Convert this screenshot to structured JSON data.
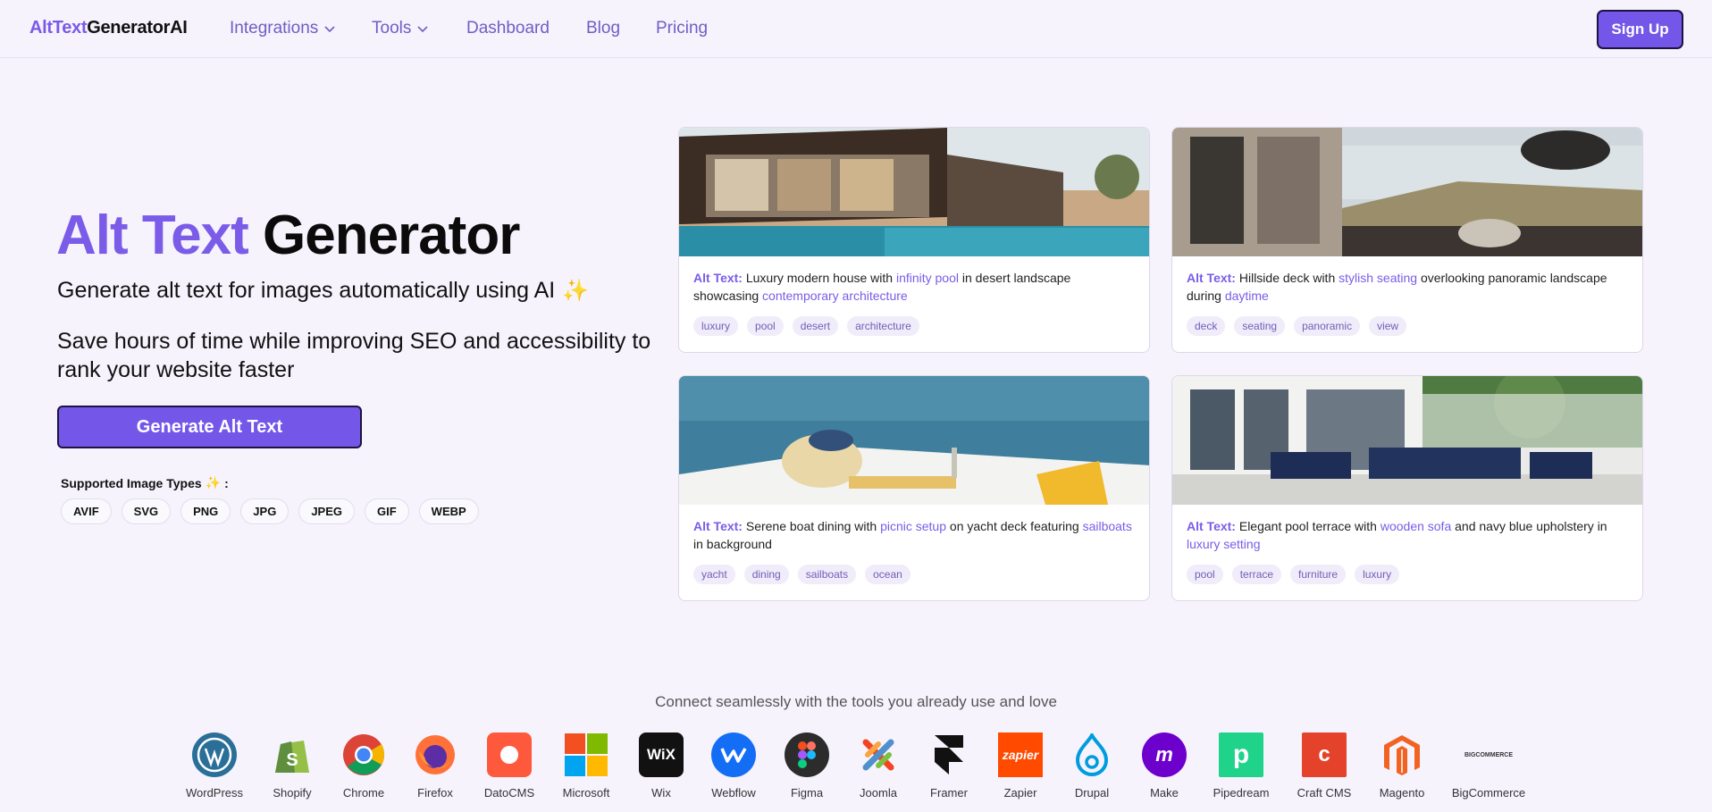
{
  "nav": {
    "brand_a": "AltText",
    "brand_b": "GeneratorAI",
    "links": [
      "Integrations",
      "Tools",
      "Dashboard",
      "Blog",
      "Pricing"
    ],
    "signup": "Sign Up"
  },
  "hero": {
    "title_a": "Alt Text",
    "title_b": "Generator",
    "sub1": "Generate alt text for images automatically using AI",
    "sub2": "Save hours of time while improving SEO and accessibility to rank your website faster",
    "cta": "Generate Alt Text",
    "types_label": "Supported Image Types",
    "types": [
      "AVIF",
      "SVG",
      "PNG",
      "JPG",
      "JPEG",
      "GIF",
      "WEBP"
    ]
  },
  "cards": [
    {
      "label": "Alt Text:",
      "t1": "Luxury modern house with",
      "h1": "infinity pool",
      "t2": "in desert landscape showcasing",
      "h2": "contemporary architecture",
      "t3": "",
      "tags": [
        "luxury",
        "pool",
        "desert",
        "architecture"
      ]
    },
    {
      "label": "Alt Text:",
      "t1": "Hillside deck with",
      "h1": "stylish seating",
      "t2": "overlooking panoramic landscape during",
      "h2": "daytime",
      "t3": "",
      "tags": [
        "deck",
        "seating",
        "panoramic",
        "view"
      ]
    },
    {
      "label": "Alt Text:",
      "t1": "Serene boat dining with",
      "h1": "picnic setup",
      "t2": "on yacht deck featuring",
      "h2": "sailboats",
      "t3": "in background",
      "tags": [
        "yacht",
        "dining",
        "sailboats",
        "ocean"
      ]
    },
    {
      "label": "Alt Text:",
      "t1": "Elegant pool terrace with",
      "h1": "wooden sofa",
      "t2": "and navy blue upholstery in",
      "h2": "luxury setting",
      "t3": "",
      "tags": [
        "pool",
        "terrace",
        "furniture",
        "luxury"
      ]
    }
  ],
  "integrations": {
    "heading": "Connect seamlessly with the tools you already use and love",
    "items": [
      "WordPress",
      "Shopify",
      "Chrome",
      "Firefox",
      "DatoCMS",
      "Microsoft",
      "Wix",
      "Webflow",
      "Figma",
      "Joomla",
      "Framer",
      "Zapier",
      "Drupal",
      "Make",
      "Pipedream",
      "Craft CMS",
      "Magento",
      "BigCommerce"
    ],
    "icon_text": {
      "zapier": "zapier",
      "wix": "WiX",
      "bigcommerce": "BIGCOMMERCE"
    }
  },
  "colors": {
    "accent": "#7457e8",
    "background": "#f6f3fd",
    "highlight": "#7a5ce8"
  }
}
